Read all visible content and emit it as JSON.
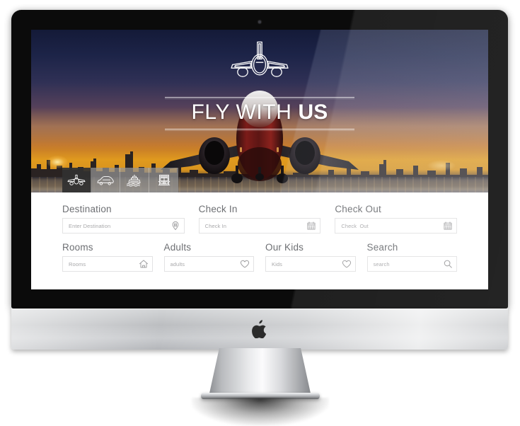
{
  "device": {
    "brand_icon": "apple-logo",
    "camera": "webcam-dot"
  },
  "hero": {
    "logo_icon": "airplane-front-logo",
    "title_light": "FLY WITH ",
    "title_bold": "US",
    "title_full": "FLY WITH US",
    "image_description": "airliner taking off at sunset over a city skyline"
  },
  "modes": [
    {
      "id": "flight",
      "icon": "airplane-icon",
      "label": "Flights",
      "active": true
    },
    {
      "id": "car",
      "icon": "car-icon",
      "label": "Cars",
      "active": false
    },
    {
      "id": "cruise",
      "icon": "ship-icon",
      "label": "Cruises",
      "active": false
    },
    {
      "id": "train",
      "icon": "train-icon",
      "label": "Trains",
      "active": false
    }
  ],
  "form": {
    "row1": [
      {
        "id": "destination",
        "label": "Destination",
        "placeholder": "Enter Destination",
        "value": "",
        "icon": "map-pin-icon"
      },
      {
        "id": "checkin",
        "label": "Check In",
        "placeholder": "Check In",
        "value": "",
        "icon": "calendar-icon"
      },
      {
        "id": "checkout",
        "label": "Check Out",
        "placeholder": "Check  Out",
        "value": "",
        "icon": "calendar-icon"
      }
    ],
    "row2": [
      {
        "id": "rooms",
        "label": "Rooms",
        "placeholder": "Rooms",
        "value": "",
        "icon": "home-icon"
      },
      {
        "id": "adults",
        "label": "Adults",
        "placeholder": "adults",
        "value": "",
        "icon": "heart-icon"
      },
      {
        "id": "kids",
        "label": "Our Kids",
        "placeholder": "Kids",
        "value": "",
        "icon": "heart-icon"
      },
      {
        "id": "search",
        "label": "Search",
        "placeholder": "search",
        "value": "",
        "icon": "search-icon"
      }
    ]
  },
  "colors": {
    "label_text": "#6d6f73",
    "placeholder_text": "#a8a8aa",
    "field_border": "#e3e3e4",
    "panel_bg": "#ffffff",
    "mode_active_bg": "#303030",
    "mode_bg": "#969696",
    "bezel": "#0b0b0b",
    "chin": "#bcbec1"
  }
}
